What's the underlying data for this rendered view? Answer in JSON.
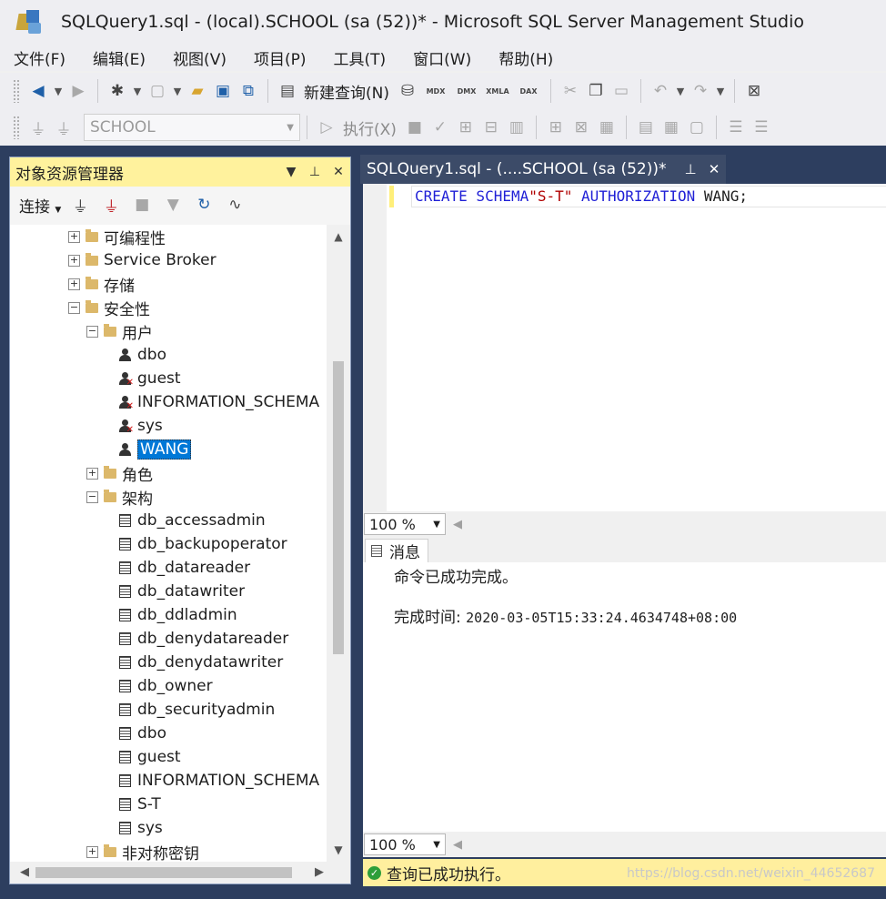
{
  "window": {
    "title": "SQLQuery1.sql - (local).SCHOOL (sa (52))* - Microsoft SQL Server Management Studio"
  },
  "menu": [
    "文件(F)",
    "编辑(E)",
    "视图(V)",
    "项目(P)",
    "工具(T)",
    "窗口(W)",
    "帮助(H)"
  ],
  "toolbar1": {
    "new_query_label": "新建查询(N)",
    "mdx": "MDX",
    "dmx": "DMX",
    "xmla": "XMLA",
    "dax": "DAX"
  },
  "toolbar2": {
    "database": "SCHOOL",
    "execute_label": "执行(X)"
  },
  "object_explorer": {
    "title": "对象资源管理器",
    "connect_label": "连接",
    "tree": [
      {
        "label": "可编程性",
        "kind": "folder",
        "level": 0,
        "expander": "+"
      },
      {
        "label": "Service Broker",
        "kind": "folder",
        "level": 0,
        "expander": "+"
      },
      {
        "label": "存储",
        "kind": "folder",
        "level": 0,
        "expander": "+"
      },
      {
        "label": "安全性",
        "kind": "folder",
        "level": 0,
        "expander": "−"
      },
      {
        "label": "用户",
        "kind": "folder",
        "level": 1,
        "expander": "−"
      },
      {
        "label": "dbo",
        "kind": "user",
        "level": 2
      },
      {
        "label": "guest",
        "kind": "user-x",
        "level": 2
      },
      {
        "label": "INFORMATION_SCHEMA",
        "kind": "user-x",
        "level": 2
      },
      {
        "label": "sys",
        "kind": "user-x",
        "level": 2
      },
      {
        "label": "WANG",
        "kind": "user",
        "level": 2,
        "selected": true
      },
      {
        "label": "角色",
        "kind": "folder",
        "level": 1,
        "expander": "+"
      },
      {
        "label": "架构",
        "kind": "folder",
        "level": 1,
        "expander": "−"
      },
      {
        "label": "db_accessadmin",
        "kind": "schema",
        "level": 2
      },
      {
        "label": "db_backupoperator",
        "kind": "schema",
        "level": 2
      },
      {
        "label": "db_datareader",
        "kind": "schema",
        "level": 2
      },
      {
        "label": "db_datawriter",
        "kind": "schema",
        "level": 2
      },
      {
        "label": "db_ddladmin",
        "kind": "schema",
        "level": 2
      },
      {
        "label": "db_denydatareader",
        "kind": "schema",
        "level": 2
      },
      {
        "label": "db_denydatawriter",
        "kind": "schema",
        "level": 2
      },
      {
        "label": "db_owner",
        "kind": "schema",
        "level": 2
      },
      {
        "label": "db_securityadmin",
        "kind": "schema",
        "level": 2
      },
      {
        "label": "dbo",
        "kind": "schema",
        "level": 2
      },
      {
        "label": "guest",
        "kind": "schema",
        "level": 2
      },
      {
        "label": "INFORMATION_SCHEMA",
        "kind": "schema",
        "level": 2
      },
      {
        "label": "S-T",
        "kind": "schema",
        "level": 2
      },
      {
        "label": "sys",
        "kind": "schema",
        "level": 2
      },
      {
        "label": "非对称密钥",
        "kind": "folder",
        "level": 1,
        "expander": "+"
      }
    ]
  },
  "editor": {
    "tab_title": "SQLQuery1.sql - (....SCHOOL (sa (52))*",
    "code": {
      "kw1": "CREATE SCHEMA",
      "str": "\"S-T\"",
      "kw2": " AUTHORIZATION",
      "rest": " WANG;"
    },
    "zoom": "100 %"
  },
  "results": {
    "tab_label": "消息",
    "line1": "命令已成功完成。",
    "line2_label": "完成时间: ",
    "line2_value": "2020-03-05T15:33:24.4634748+08:00",
    "zoom": "100 %"
  },
  "status": {
    "text": "查询已成功执行。",
    "watermark": "https://blog.csdn.net/weixin_44652687"
  }
}
